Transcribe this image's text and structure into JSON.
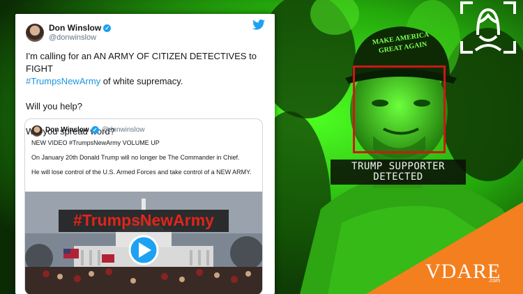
{
  "tweet": {
    "name": "Don Winslow",
    "handle": "@donwinslow",
    "text_line1": "I'm calling for an AN ARMY OF CITIZEN DETECTIVES to FIGHT",
    "text_hashtag": "#TrumpsNewArmy",
    "text_line2_rest": " of white supremacy.",
    "text_line3": "Will you help?",
    "text_line4": "Will you spread word?"
  },
  "quote": {
    "name": "Don Winslow",
    "handle": "@donwinslow",
    "line1": "NEW VIDEO  #TrumpsNewArmy    VOLUME UP",
    "line2": "On January 20th Donald Trump will no longer be The Commander in Chief.",
    "line3": "He will lose control of the U.S. Armed Forces and take control of a NEW ARMY.",
    "image_banner": "#TrumpsNewArmy"
  },
  "hat_text": "MAKE AMERICA GREAT AGAIN",
  "detection": {
    "line1": "TRUMP SUPPORTER",
    "line2": "DETECTED"
  },
  "brand": {
    "name": "VDARE",
    "tld": ".com"
  },
  "colors": {
    "green_tint": "#39e61a",
    "orange_corner": "#f47f1f",
    "box_red": "#d01616",
    "twitter_blue": "#1da1f2"
  }
}
